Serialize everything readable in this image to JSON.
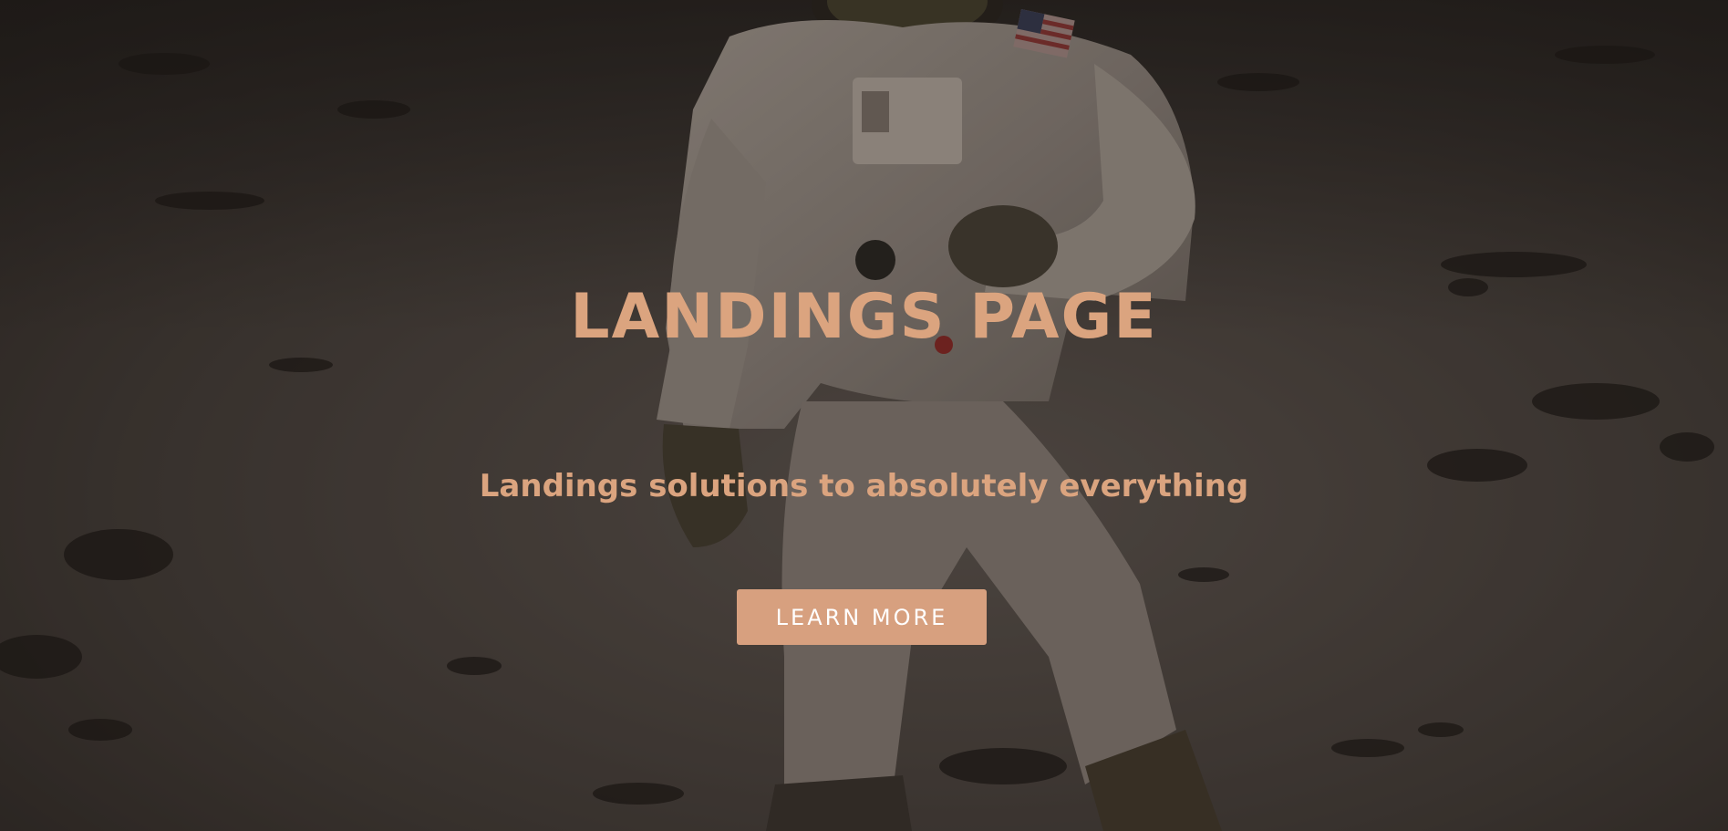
{
  "hero": {
    "title": "LANDINGS PAGE",
    "subtitle": "Landings solutions to absolutely everything",
    "cta_label": "LEARN MORE",
    "background_image": "astronaut-on-moon-photo"
  },
  "colors": {
    "accent": "#dba47f",
    "button_bg": "#d7a07f",
    "button_text": "#ffffff",
    "overlay": "#14100e"
  }
}
